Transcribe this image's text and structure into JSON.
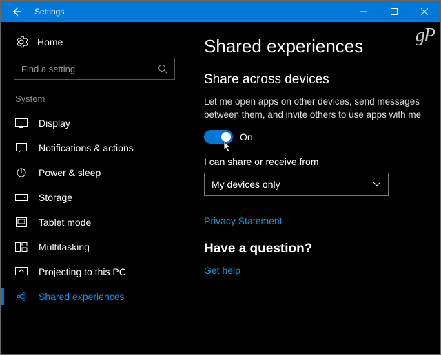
{
  "titlebar": {
    "title": "Settings"
  },
  "sidebar": {
    "home": "Home",
    "search_placeholder": "Find a setting",
    "category": "System",
    "items": [
      {
        "label": "Display"
      },
      {
        "label": "Notifications & actions"
      },
      {
        "label": "Power & sleep"
      },
      {
        "label": "Storage"
      },
      {
        "label": "Tablet mode"
      },
      {
        "label": "Multitasking"
      },
      {
        "label": "Projecting to this PC"
      },
      {
        "label": "Shared experiences",
        "selected": true
      }
    ]
  },
  "main": {
    "title": "Shared experiences",
    "section1_title": "Share across devices",
    "section1_desc": "Let me open apps on other devices, send messages between them, and invite others to use apps with me",
    "toggle_state": "On",
    "toggle_value": true,
    "share_from_label": "I can share or receive from",
    "share_from_value": "My devices only",
    "privacy_link": "Privacy Statement",
    "question_title": "Have a question?",
    "get_help": "Get help"
  },
  "watermark": "gP",
  "colors": {
    "accent": "#0078d7",
    "link": "#0099e6",
    "bg": "#000000"
  }
}
